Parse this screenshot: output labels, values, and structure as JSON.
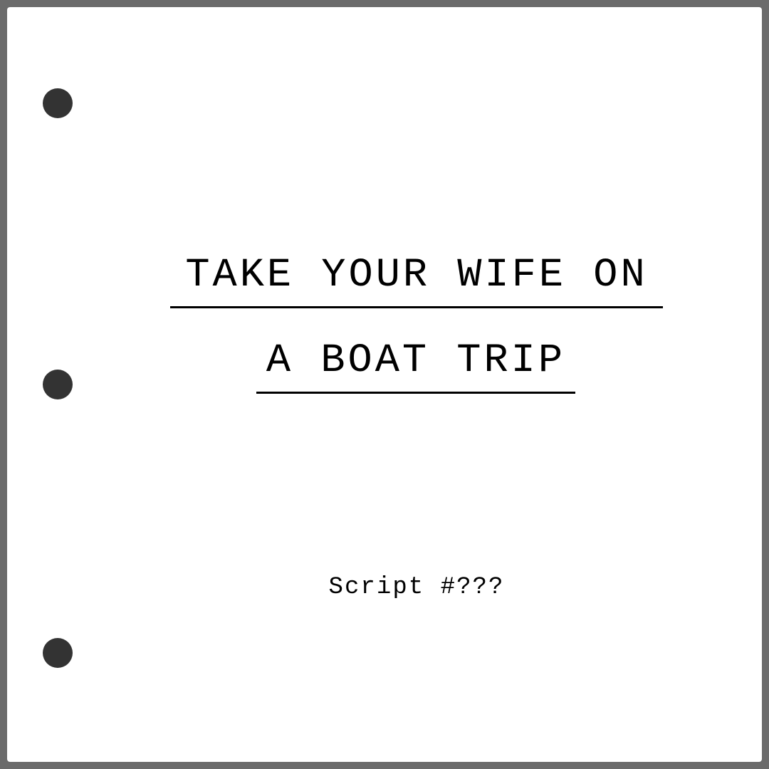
{
  "page": {
    "background_color": "#6b6b6b",
    "paper_color": "#ffffff",
    "hole_color": "#333333",
    "holes": [
      "punch-hole",
      "punch-hole",
      "punch-hole"
    ]
  },
  "title": {
    "line1": "TAKE YOUR WIFE ON",
    "line2": "A BOAT TRIP"
  },
  "script_number": "Script #???"
}
